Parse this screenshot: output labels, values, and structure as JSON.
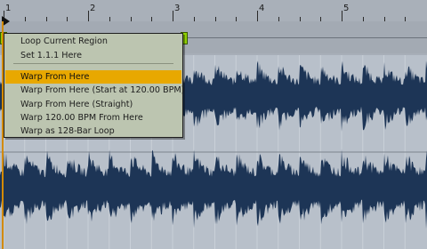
{
  "ruler": {
    "bar_numbers": [
      "1",
      "2",
      "3",
      "4",
      "5"
    ]
  },
  "context_menu": {
    "items": [
      {
        "label": "Loop Current Region"
      },
      {
        "label": "Set 1.1.1 Here"
      },
      {
        "label": "Warp From Here",
        "highlighted": true
      },
      {
        "label": "Warp From Here (Start at 120.00 BPM)"
      },
      {
        "label": "Warp From Here (Straight)"
      },
      {
        "label": "Warp 120.00 BPM From Here"
      },
      {
        "label": "Warp as 128-Bar Loop"
      }
    ]
  },
  "colors": {
    "waveform": "#1d3556",
    "highlight": "#e8a800",
    "marker": "#8fd000",
    "start_line": "#d38a00"
  }
}
